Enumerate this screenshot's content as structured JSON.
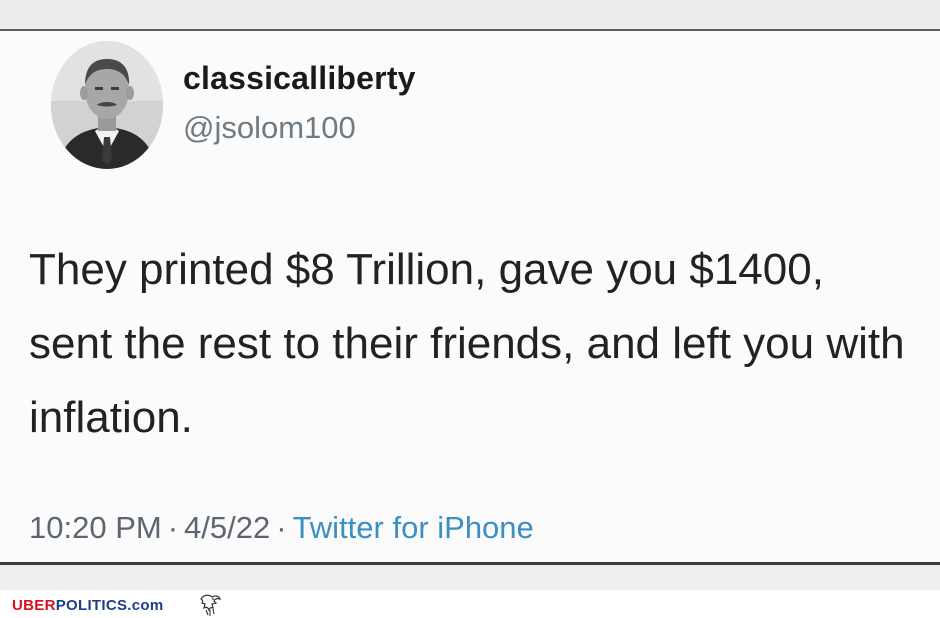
{
  "tweet": {
    "display_name": "classicalliberty",
    "handle": "@jsolom100",
    "text": "They printed $8 Trillion, gave you $1400, sent the rest to their friends, and left you with inflation.",
    "time": "10:20 PM",
    "separator": "·",
    "date": "4/5/22",
    "source": "Twitter for iPhone"
  },
  "footer": {
    "logo_part1": "UBER",
    "logo_part2": "POLITICS",
    "logo_part3": ".com"
  },
  "icons": {
    "avatar": "profile-photo",
    "eagle": "eagle-icon"
  },
  "colors": {
    "name": "#1a1a1a",
    "handle": "#6f7a83",
    "text": "#222222",
    "meta": "#5d6670",
    "source_link": "#3a8fc4",
    "logo_red": "#d4131b",
    "logo_blue": "#1e3d8f"
  }
}
